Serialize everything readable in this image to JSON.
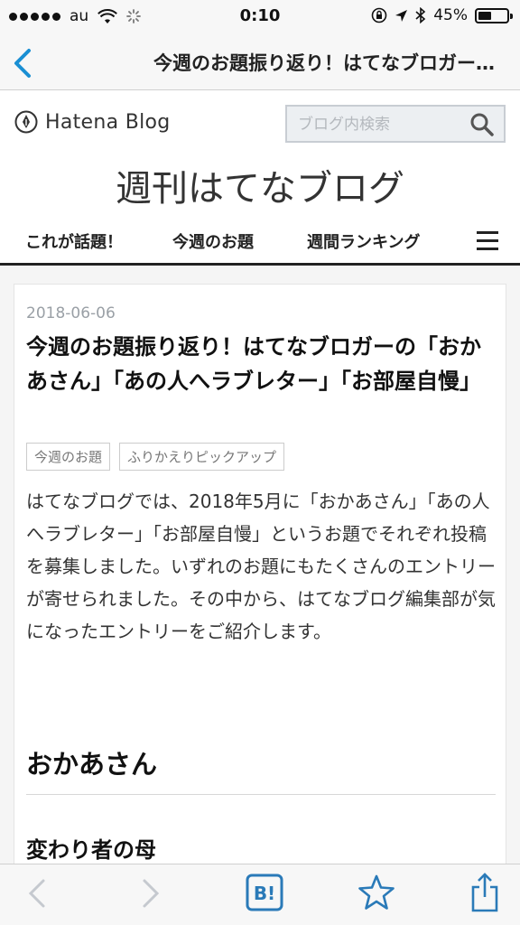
{
  "status_bar": {
    "carrier": "au",
    "time": "0:10",
    "battery_percent": "45%",
    "battery_level": 0.45
  },
  "nav_bar": {
    "title": "今週のお題振り返り！はてなブロガー…"
  },
  "header": {
    "logo_text": "Hatena Blog",
    "search_placeholder": "ブログ内検索",
    "blog_title": "週刊はてなブログ",
    "nav_items": [
      "これが話題！",
      "今週のお題",
      "週間ランキング"
    ]
  },
  "article": {
    "date": "2018-06-06",
    "title": "今週のお題振り返り！はてなブロガーの「おかあさん」「あの人へラブレター」「お部屋自慢」",
    "tags": [
      "今週のお題",
      "ふりかえりピックアップ"
    ],
    "body": "はてなブログでは、2018年5月に「おかあさん」「あの人へラブレター」「お部屋自慢」というお題でそれぞれ投稿を募集しました。いずれのお題にもたくさんのエントリーが寄せられました。その中から、はてなブログ編集部が気になったエントリーをご紹介します。",
    "section_heading": "おかあさん",
    "subsection_heading": "変わり者の母"
  },
  "toolbar": {
    "bookmark_label": "B!"
  },
  "colors": {
    "accent_blue": "#1a8fd3",
    "status_blue": "#2a7ab8",
    "text_dark": "#222222",
    "meta_gray": "#9aa0a6"
  }
}
